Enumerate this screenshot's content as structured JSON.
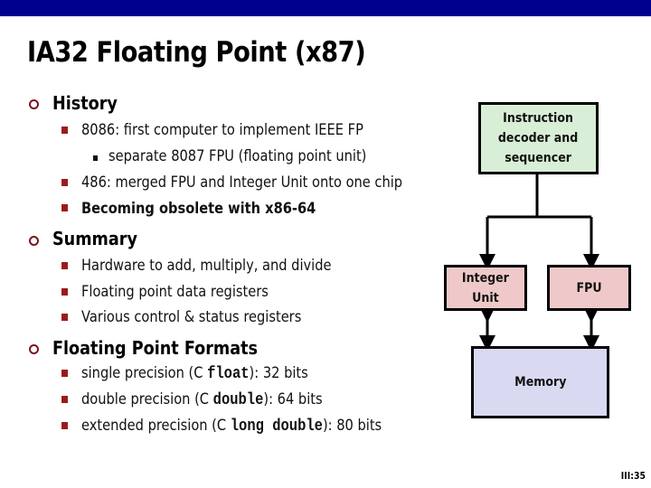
{
  "slide": {
    "title": "IA32 Floating Point (x87)",
    "page_number": "III:35",
    "accent_bar_color": "#00008f"
  },
  "sections": [
    {
      "heading": "History",
      "items": [
        {
          "text": "8086: first computer to implement IEEE FP",
          "level": 2
        },
        {
          "text": "separate 8087 FPU (floating point unit)",
          "level": 3
        },
        {
          "text": "486: merged FPU and Integer Unit onto one chip",
          "level": 2
        },
        {
          "text": "Becoming obsolete with x86-64",
          "level": 2,
          "bold": true
        }
      ]
    },
    {
      "heading": "Summary",
      "items": [
        {
          "text": "Hardware to add, multiply, and divide",
          "level": 2
        },
        {
          "text": "Floating point data registers",
          "level": 2
        },
        {
          "text": "Various control & status registers",
          "level": 2
        }
      ]
    },
    {
      "heading": "Floating Point Formats",
      "items": [
        {
          "prefix": "single precision (C ",
          "code": "float",
          "suffix": "): 32 bits",
          "level": 2
        },
        {
          "prefix": "double precision (C ",
          "code": "double",
          "suffix": "): 64 bits",
          "level": 2
        },
        {
          "prefix": "extended precision (C ",
          "code": "long double",
          "suffix": "): 80 bits",
          "level": 2
        }
      ]
    }
  ],
  "diagram": {
    "instruction_box": {
      "line1": "Instruction",
      "line2": "decoder and",
      "line3": "sequencer",
      "color": "#d8eed6"
    },
    "integer_box": {
      "line1": "Integer",
      "line2": "Unit",
      "color": "#efc9c9"
    },
    "fpu_box": {
      "label": "FPU",
      "color": "#efc9c9"
    },
    "memory_box": {
      "label": "Memory",
      "color": "#d9daf2"
    }
  }
}
